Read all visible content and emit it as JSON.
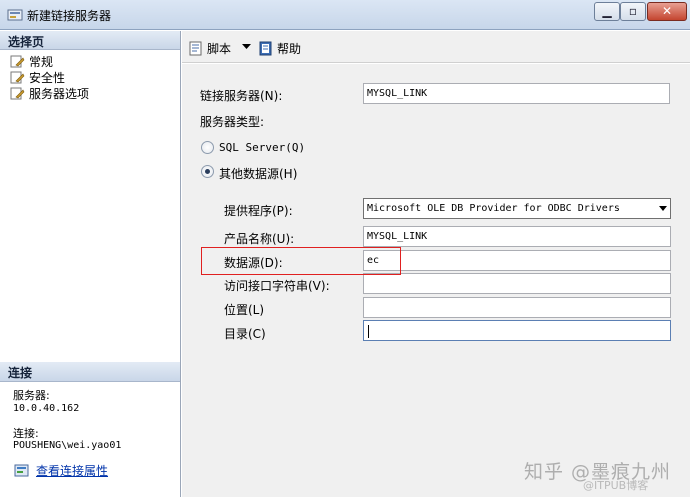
{
  "window": {
    "title": "新建链接服务器",
    "minimize": "▁",
    "maximize": "▫",
    "close": "✕"
  },
  "left": {
    "select_page_header": "选择页",
    "pages": [
      {
        "label": "常规"
      },
      {
        "label": "安全性"
      },
      {
        "label": "服务器选项"
      }
    ],
    "connection_header": "连接",
    "server_label": "服务器:",
    "server_value": "10.0.40.162",
    "connection_label": "连接:",
    "connection_value": "POUSHENG\\wei.yao01",
    "view_link": "查看连接属性"
  },
  "toolbar": {
    "script": "脚本",
    "help": "帮助"
  },
  "form": {
    "linked_server_label": "链接服务器(N):",
    "linked_server_value": "MYSQL_LINK",
    "server_type_label": "服务器类型:",
    "sql_server_option": "SQL Server(Q)",
    "other_source_option": "其他数据源(H)",
    "selected_option": "other",
    "provider_label": "提供程序(P):",
    "provider_value": "Microsoft OLE DB Provider for ODBC Drivers",
    "product_name_label": "产品名称(U):",
    "product_name_value": "MYSQL_LINK",
    "data_source_label": "数据源(D):",
    "data_source_value": "ec",
    "provider_string_label": "访问接口字符串(V):",
    "provider_string_value": "",
    "location_label": "位置(L)",
    "location_value": "",
    "catalog_label": "目录(C)",
    "catalog_value": ""
  },
  "watermark": {
    "line1": "知乎 @墨痕九州",
    "line2": "@ITPUB博客"
  },
  "colors": {
    "highlight_box": "#e02020",
    "link": "#0033aa"
  }
}
